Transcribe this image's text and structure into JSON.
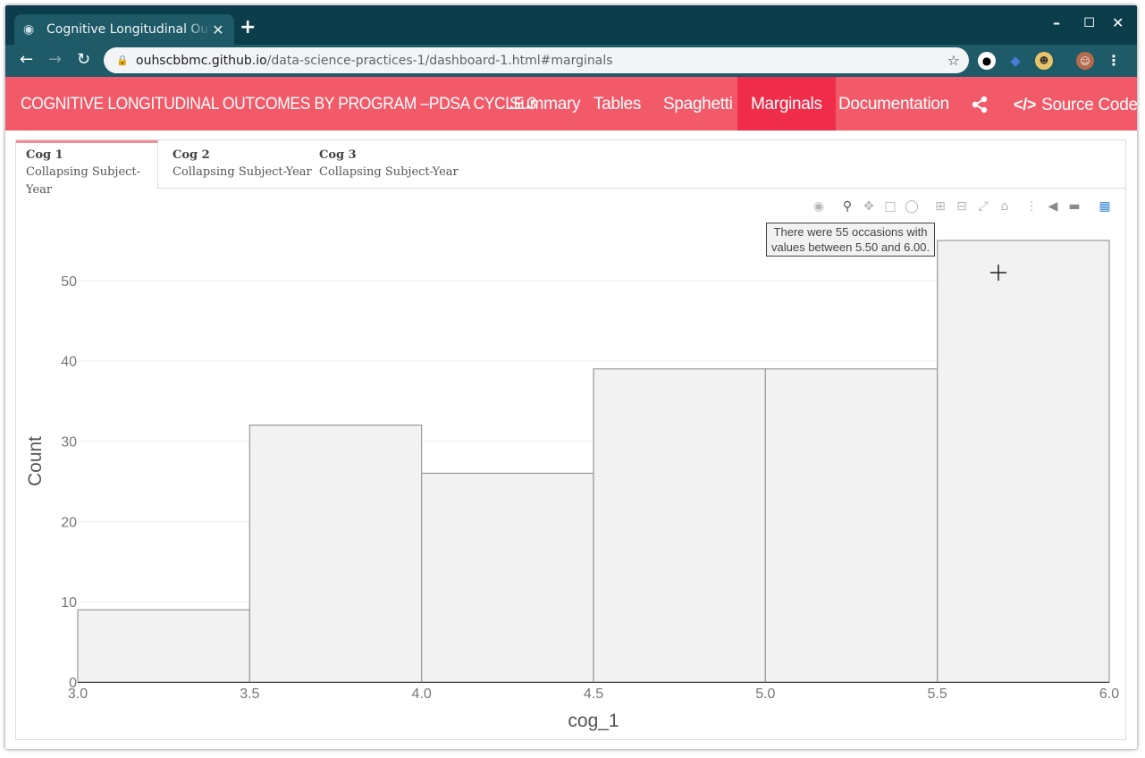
{
  "browser": {
    "tab_title": "Cognitive Longitudinal Outcomes",
    "url_host": "ouhscbbmc.github.io",
    "url_path": "/data-science-practices-1/dashboard-1.html#marginals"
  },
  "navbar": {
    "brand": "COGNITIVE LONGITUDINAL OUTCOMES BY PROGRAM –PDSA CYCLE 3",
    "links": [
      "Summary",
      "Tables",
      "Spaghetti",
      "Marginals",
      "Documentation"
    ],
    "active": "Marginals",
    "source_code": "Source Code"
  },
  "subtabs": [
    {
      "title": "Cog 1",
      "subtitle": "Collapsing Subject-Year"
    },
    {
      "title": "Cog 2",
      "subtitle": "Collapsing Subject-Year"
    },
    {
      "title": "Cog 3",
      "subtitle": "Collapsing Subject-Year"
    }
  ],
  "tooltip": {
    "line1": "There were 55 occasions with",
    "line2": "values between 5.50 and 6.00."
  },
  "chart_data": {
    "type": "bar",
    "xlabel": "cog_1",
    "ylabel": "Count",
    "bins": [
      {
        "x0": 3.0,
        "x1": 3.5,
        "count": 9
      },
      {
        "x0": 3.5,
        "x1": 4.0,
        "count": 32
      },
      {
        "x0": 4.0,
        "x1": 4.5,
        "count": 26
      },
      {
        "x0": 4.5,
        "x1": 5.0,
        "count": 39
      },
      {
        "x0": 5.0,
        "x1": 5.5,
        "count": 39
      },
      {
        "x0": 5.5,
        "x1": 6.0,
        "count": 55
      }
    ],
    "xticks": [
      "3.0",
      "3.5",
      "4.0",
      "4.5",
      "5.0",
      "5.5",
      "6.0"
    ],
    "yticks": [
      "0",
      "10",
      "20",
      "30",
      "40",
      "50"
    ],
    "xlim": [
      3.0,
      6.0
    ],
    "ylim": [
      0,
      55
    ],
    "grid": true,
    "bar_fill": "#f2f2f2",
    "bar_stroke": "#999999"
  },
  "colors": {
    "navbar_bg": "#f25a69",
    "navbar_active": "#ef2d4a",
    "browser_frame": "#0b3d4b"
  }
}
